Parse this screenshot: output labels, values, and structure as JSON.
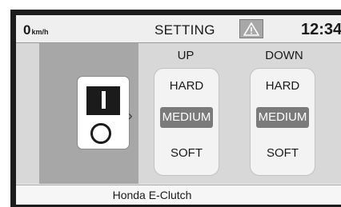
{
  "status_bar": {
    "speed_value": "0",
    "speed_unit": "km/h",
    "title": "SETTING",
    "warning_icon": "warning-triangle-icon",
    "clock": "12:34"
  },
  "illustration": {
    "icon": "clutch-switch-icon",
    "chevron": "›"
  },
  "columns": {
    "up": {
      "header": "UP",
      "options": [
        "HARD",
        "MEDIUM",
        "SOFT"
      ],
      "selected": "MEDIUM"
    },
    "down": {
      "header": "DOWN",
      "options": [
        "HARD",
        "MEDIUM",
        "SOFT"
      ],
      "selected": "MEDIUM"
    }
  },
  "footer": {
    "label": "Honda E-Clutch"
  },
  "colors": {
    "selected_bg": "#7a7a7a",
    "panel_bg": "#a7a7a7",
    "bezel": "#1c1c1c"
  }
}
